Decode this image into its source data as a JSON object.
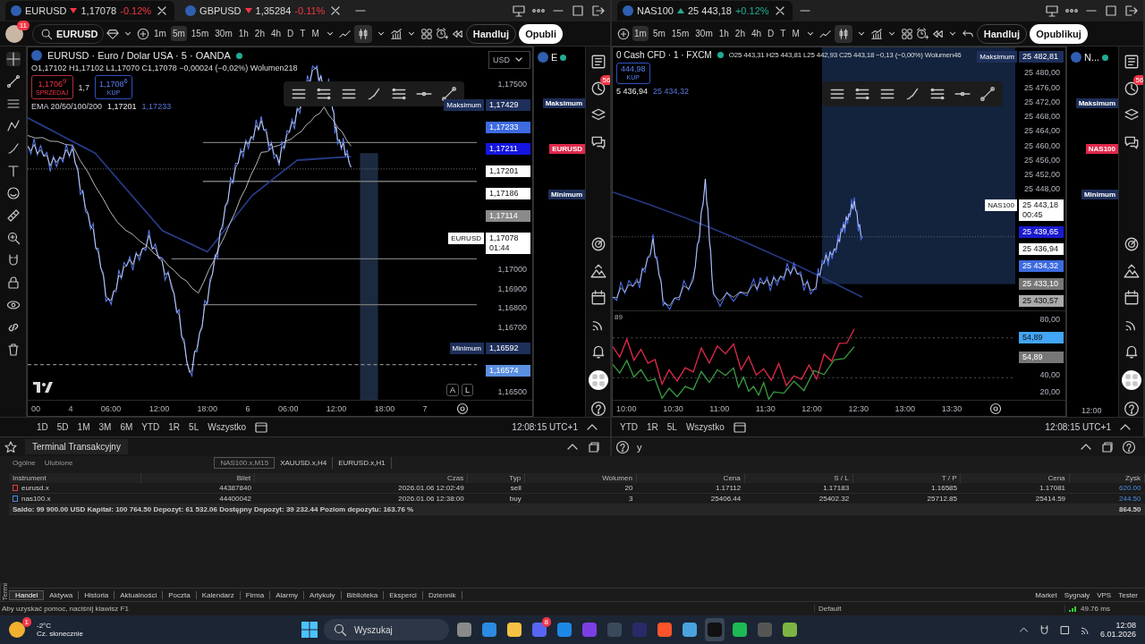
{
  "windows": [
    {
      "tabs": [
        {
          "symbol": "EURUSD",
          "falling": true,
          "price": "1,17078",
          "change": "-0.12%",
          "selected": true
        },
        {
          "symbol": "GBPUSD",
          "falling": true,
          "price": "1,35284",
          "change": "-0.11%",
          "selected": false
        }
      ],
      "toolbar": {
        "notifications": "11",
        "search": "EURUSD",
        "timeframes": [
          {
            "label": "1m",
            "selected": false
          },
          {
            "label": "5m",
            "selected": true
          },
          {
            "label": "15m",
            "selected": false
          },
          {
            "label": "30m",
            "selected": false
          },
          {
            "label": "1h",
            "selected": false
          },
          {
            "label": "2h",
            "selected": false
          },
          {
            "label": "4h",
            "selected": false
          },
          {
            "label": "D",
            "selected": false
          },
          {
            "label": "T",
            "selected": false
          },
          {
            "label": "M",
            "selected": false
          }
        ],
        "trade_button": "Handluj",
        "publish_button": "Opubli"
      },
      "legend": {
        "title": "EURUSD · Euro / Dolar USA · 5 · OANDA",
        "ohlc": "O1,17102 H1,17102 L1,17070 C1,17078 −0,00024 (−0,02%) Wolumen218",
        "sell": {
          "price": "1,1706$^{9}$",
          "label": "SPRZEDAJ"
        },
        "spread": "1,7",
        "buy": {
          "price": "1,1708$^{6}$",
          "label": "KUP"
        },
        "ema": {
          "name": "EMA 20/50/100/200",
          "values": [
            "1,17201",
            "1,17233"
          ]
        }
      },
      "currency": "USD",
      "axis": [
        {
          "kind": "tick",
          "text": "1,17500"
        },
        {
          "kind": "tag",
          "text": "1,17429",
          "color": "#1e2f5a",
          "label": "Maksimum"
        },
        {
          "kind": "tag",
          "text": "1,17233",
          "color": "#3d6be0"
        },
        {
          "kind": "tag",
          "text": "1,17211",
          "color": "#1515e0"
        },
        {
          "kind": "tag",
          "text": "1,17201",
          "color": "#ffffff"
        },
        {
          "kind": "tag",
          "text": "1,17186",
          "color": "#ffffff"
        },
        {
          "kind": "tag",
          "text": "1,17114",
          "color": "#8a8a8a"
        },
        {
          "kind": "tag",
          "text": "1,17078",
          "color": "#ffffff",
          "label": "EURUSD",
          "sub": "01:44"
        },
        {
          "kind": "tick",
          "text": "1,17000"
        },
        {
          "kind": "tick",
          "text": "1,16900"
        },
        {
          "kind": "tick",
          "text": "1,16800"
        },
        {
          "kind": "tick",
          "text": "1,16700"
        },
        {
          "kind": "tag",
          "text": "1,16592",
          "color": "#1e2f5a",
          "label": "Minimum"
        },
        {
          "kind": "tag",
          "text": "1,16574",
          "color": "#5b8fe0"
        },
        {
          "kind": "tick",
          "text": "1,16500"
        }
      ],
      "scale_buttons": [
        "A",
        "L"
      ],
      "times": [
        "00",
        "4",
        "06:00",
        "12:00",
        "18:00",
        "6",
        "06:00",
        "12:00",
        "18:00",
        "7"
      ],
      "ranges": [
        "1D",
        "5D",
        "1M",
        "3M",
        "6M",
        "YTD",
        "1R",
        "5L",
        "Wszystko"
      ],
      "clock": "12:08:15 UTC+1",
      "mini": {
        "title": "E",
        "tags": [
          {
            "text": "Maksimum",
            "color": "#1e2f5a"
          },
          {
            "text": "EURUSD",
            "color": "#e0294a"
          },
          {
            "text": "Minimum",
            "color": "#1e2f5a"
          }
        ]
      },
      "strip_badge": "56"
    },
    {
      "tabs": [
        {
          "symbol": "NAS100",
          "falling": false,
          "price": "25 443,18",
          "change": "+0.12%",
          "selected": true
        }
      ],
      "toolbar": {
        "timeframes": [
          {
            "label": "1m",
            "selected": true
          },
          {
            "label": "5m",
            "selected": false
          },
          {
            "label": "15m",
            "selected": false
          },
          {
            "label": "30m",
            "selected": false
          },
          {
            "label": "1h",
            "selected": false
          },
          {
            "label": "2h",
            "selected": false
          },
          {
            "label": "4h",
            "selected": false
          },
          {
            "label": "D",
            "selected": false
          },
          {
            "label": "T",
            "selected": false
          },
          {
            "label": "M",
            "selected": false
          }
        ],
        "trade_button": "Handluj",
        "publish_button": "Opublikuj"
      },
      "legend": {
        "title": "0 Cash CFD · 1 · FXCM",
        "ohlc": "O25 443,31 H25 443,81 L25 442,93 C25 443,18 −0,13 (−0,00%) Wolumen46",
        "buy": {
          "price": "444,98",
          "label": "KUP"
        },
        "ema": {
          "values": [
            "5 436,94",
            "25 434,32"
          ]
        }
      },
      "axis": [
        {
          "kind": "tag",
          "text": "25 482,81",
          "color": "#1e2f5a",
          "label": "Maksimum"
        },
        {
          "kind": "tick",
          "text": "25 480,00"
        },
        {
          "kind": "tick",
          "text": "25 476,00"
        },
        {
          "kind": "tick",
          "text": "25 472,00"
        },
        {
          "kind": "tick",
          "text": "25 468,00"
        },
        {
          "kind": "tick",
          "text": "25 464,00"
        },
        {
          "kind": "tick",
          "text": "25 460,00"
        },
        {
          "kind": "tick",
          "text": "25 456,00"
        },
        {
          "kind": "tick",
          "text": "25 452,00"
        },
        {
          "kind": "tick",
          "text": "25 448,00"
        },
        {
          "kind": "tag",
          "text": "25 443,18",
          "color": "#ffffff",
          "label": "NAS100",
          "sub": "00:45"
        },
        {
          "kind": "tag",
          "text": "25 439,65",
          "color": "#1a1ad0"
        },
        {
          "kind": "tag",
          "text": "25 436,94",
          "color": "#ffffff"
        },
        {
          "kind": "tag",
          "text": "25 434,32",
          "color": "#3d6be0"
        },
        {
          "kind": "tag",
          "text": "25 433,10",
          "color": "#777777"
        },
        {
          "kind": "tag",
          "text": "25 430,57",
          "color": "#aaaaaa"
        }
      ],
      "oscillator": {
        "level_label": "89",
        "axis": [
          {
            "kind": "tick",
            "text": "80,00"
          },
          {
            "kind": "tag",
            "text": "54,89",
            "color": "#42a5f5"
          },
          {
            "kind": "tag",
            "text": "54,89",
            "color": "#777777"
          },
          {
            "kind": "tick",
            "text": "40,00"
          },
          {
            "kind": "tick",
            "text": "20,00"
          }
        ]
      },
      "times": [
        "10:00",
        "10:30",
        "11:00",
        "11:30",
        "12:00",
        "12:30",
        "13:00",
        "13:30"
      ],
      "ranges": [
        "YTD",
        "1R",
        "5L",
        "Wszystko"
      ],
      "clock": "12:08:15 UTC+1",
      "mini": {
        "title": "N...",
        "tags": [
          {
            "text": "Maksimum",
            "color": "#1e2f5a"
          },
          {
            "text": "NAS100",
            "color": "#e0294a"
          },
          {
            "text": "Minimum",
            "color": "#1e2f5a"
          }
        ],
        "time": "12:00"
      },
      "strip_badge": "56"
    }
  ],
  "terminal": {
    "title": "Terminal Transakcyjny",
    "fragment": "y",
    "side_label": "Termi",
    "groups": [
      {
        "label": "Ogólne",
        "selected": false
      },
      {
        "label": "Ulubione",
        "selected": false
      }
    ],
    "charts": [
      {
        "label": "NAS100.x,M15",
        "selected": true
      },
      {
        "label": "XAUUSD.x,H4",
        "selected": false
      },
      {
        "label": "EURUSD.x,H1",
        "selected": false
      }
    ],
    "columns": [
      "Instrument",
      "Bilet",
      "Czas",
      "Typ",
      "Wolumen",
      "Cena",
      "S / L",
      "T / P",
      "Cena",
      "Zysk"
    ],
    "rows": [
      {
        "color": "#e04040",
        "cells": [
          "eurusd.x",
          "44387840",
          "2026.01.06 12:02:49",
          "sell",
          "20",
          "1.17112",
          "1.17183",
          "1.16585",
          "1.17081",
          "620.00"
        ]
      },
      {
        "color": "#4a8ae0",
        "cells": [
          "nas100.x",
          "44400042",
          "2026.01.06 12:38:00",
          "buy",
          "3",
          "25406.44",
          "25402.32",
          "25712.85",
          "25414.59",
          "244.50"
        ]
      }
    ],
    "summary": "Saldo: 99 900.00 USD  Kapitał: 100 764.50  Depozyt: 61 532.06  Dostępny Depozyt: 39 232.44  Poziom depozytu: 163.76 %",
    "summary_total": "864.50",
    "tabs": [
      {
        "label": "Handel",
        "selected": true
      },
      {
        "label": "Aktywa",
        "selected": false
      },
      {
        "label": "Historia",
        "selected": false
      },
      {
        "label": "Aktualności",
        "selected": false
      },
      {
        "label": "Poczta",
        "selected": false
      },
      {
        "label": "Kalendarz",
        "selected": false
      },
      {
        "label": "Firma",
        "selected": false
      },
      {
        "label": "Alarmy",
        "selected": false
      },
      {
        "label": "Artykuły",
        "selected": false
      },
      {
        "label": "Biblioteka",
        "selected": false
      },
      {
        "label": "Eksperci",
        "selected": false
      },
      {
        "label": "Dziennik",
        "selected": false
      }
    ],
    "services": [
      "Market",
      "Sygnały",
      "VPS",
      "Tester"
    ]
  },
  "status_bar": {
    "help": "Aby uzyskać pomoc, naciśnij klawisz F1",
    "profile": "Default",
    "ping": "49.76 ms"
  },
  "taskbar": {
    "weather": {
      "badge": "1",
      "temp": "-2°C",
      "text": "Cz. słonecznie"
    },
    "search": "Wyszukaj",
    "apps": [
      {
        "color": "#8a8a8a",
        "selected": false
      },
      {
        "color": "#2b8be0",
        "selected": false
      },
      {
        "color": "#f5c242",
        "selected": false
      },
      {
        "color": "#5865f2",
        "selected": false,
        "badge": "8"
      },
      {
        "color": "#1e88e5",
        "selected": false
      },
      {
        "color": "#7b3fe4",
        "selected": false
      },
      {
        "color": "#3a4a5a",
        "selected": false
      },
      {
        "color": "#2a2a6a",
        "selected": false
      },
      {
        "color": "#fb542b",
        "selected": false
      },
      {
        "color": "#4aa3df",
        "selected": false
      },
      {
        "color": "#111111",
        "selected": true
      },
      {
        "color": "#1db954",
        "selected": false
      },
      {
        "color": "#555555",
        "selected": false
      },
      {
        "color": "#7cb342",
        "selected": false
      }
    ],
    "time": "12:08",
    "date": "6.01.2026"
  }
}
